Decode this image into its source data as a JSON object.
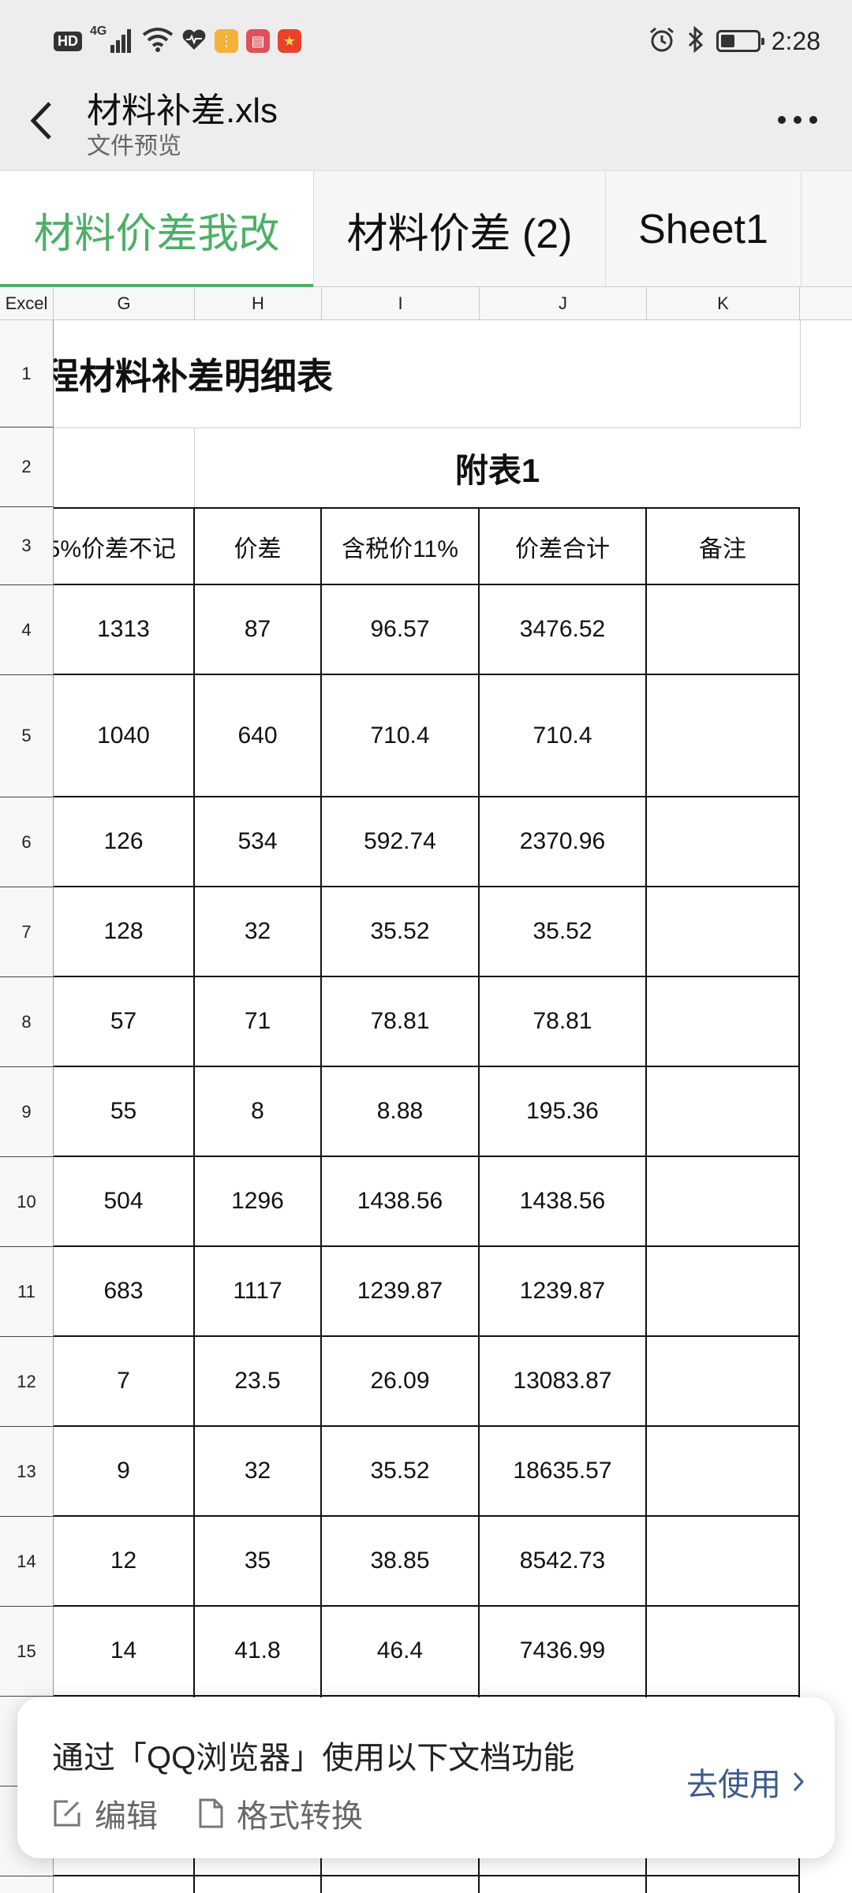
{
  "status_bar": {
    "time": "2:28",
    "hd": "HD",
    "network": "4G",
    "battery_level": 0.35
  },
  "header": {
    "title": "材料补差.xls",
    "subtitle": "文件预览"
  },
  "tabs": [
    {
      "label": "材料价差我改",
      "active": true
    },
    {
      "label": "材料价差 (2)",
      "active": false
    },
    {
      "label": "Sheet1",
      "active": false
    }
  ],
  "grid": {
    "corner": "Excel",
    "columns": [
      "G",
      "H",
      "I",
      "J",
      "K"
    ],
    "title": "程材料补差明细表",
    "appendix": "附表1",
    "headers": [
      "5%价差不记",
      "价差",
      "含税价11%",
      "价差合计",
      "备注"
    ],
    "rows": [
      {
        "num": "1"
      },
      {
        "num": "2"
      },
      {
        "num": "3"
      },
      {
        "num": "4",
        "g": "1313",
        "h": "87",
        "i": "96.57",
        "j": "3476.52"
      },
      {
        "num": "5",
        "g": "1040",
        "h": "640",
        "i": "710.4",
        "j": "710.4"
      },
      {
        "num": "6",
        "g": "126",
        "h": "534",
        "i": "592.74",
        "j": "2370.96"
      },
      {
        "num": "7",
        "g": "128",
        "h": "32",
        "i": "35.52",
        "j": "35.52"
      },
      {
        "num": "8",
        "g": "57",
        "h": "71",
        "i": "78.81",
        "j": "78.81"
      },
      {
        "num": "9",
        "g": "55",
        "h": "8",
        "i": "8.88",
        "j": "195.36"
      },
      {
        "num": "10",
        "g": "504",
        "h": "1296",
        "i": "1438.56",
        "j": "1438.56"
      },
      {
        "num": "11",
        "g": "683",
        "h": "1117",
        "i": "1239.87",
        "j": "1239.87"
      },
      {
        "num": "12",
        "g": "7",
        "h": "23.5",
        "i": "26.09",
        "j": "13083.87"
      },
      {
        "num": "13",
        "g": "9",
        "h": "32",
        "i": "35.52",
        "j": "18635.57"
      },
      {
        "num": "14",
        "g": "12",
        "h": "35",
        "i": "38.85",
        "j": "8542.73"
      },
      {
        "num": "15",
        "g": "14",
        "h": "41.8",
        "i": "46.4",
        "j": "7436.99"
      }
    ]
  },
  "promo": {
    "text": "通过「QQ浏览器」使用以下文档功能",
    "edit": "编辑",
    "convert": "格式转换",
    "action": "去使用"
  },
  "colors": {
    "accent": "#4caf66",
    "link": "#3a5a8c"
  }
}
